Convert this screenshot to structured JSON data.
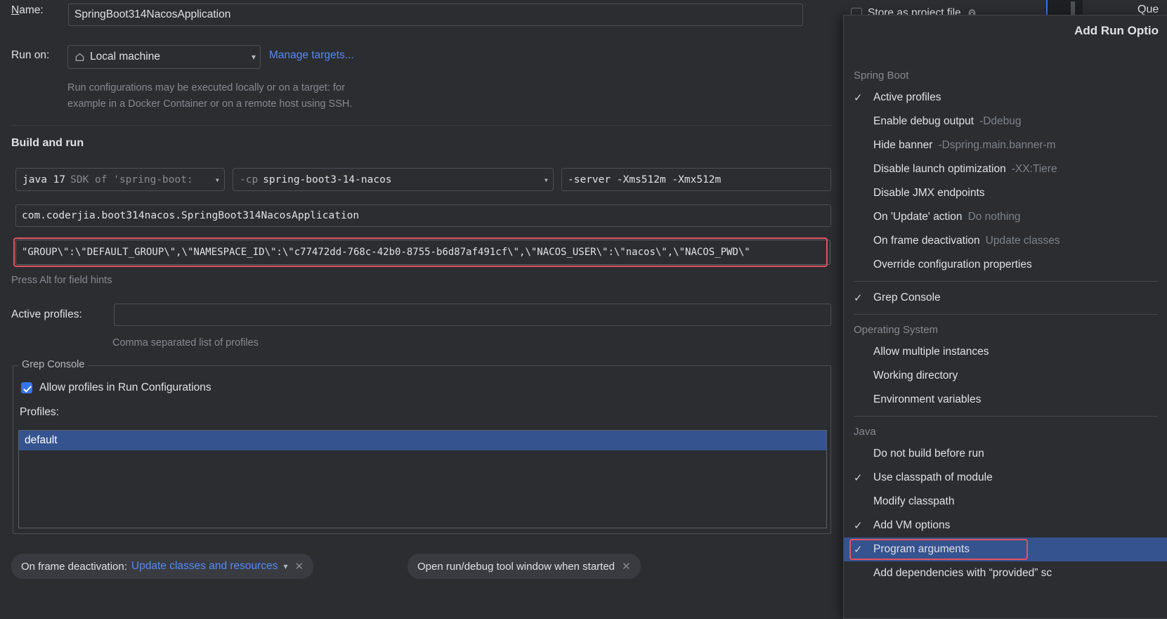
{
  "dialog": {
    "name_label": "Name:",
    "name_value": "SpringBoot314NacosApplication",
    "run_on_label": "Run on:",
    "run_on_value": "Local machine",
    "run_on_icon": "home-icon",
    "manage_targets_link": "Manage targets...",
    "run_on_hint_line1": "Run configurations may be executed locally or on a target: for",
    "run_on_hint_line2": "example in a Docker Container or on a remote host using SSH.",
    "build_and_run_title": "Build and run",
    "jdk_value_bold": "java 17",
    "jdk_value_dim": "SDK of 'spring-boot:",
    "cp_prefix": "-cp",
    "cp_value": "spring-boot3-14-nacos",
    "vm_options_value": "-server -Xms512m -Xmx512m",
    "main_class_value": "com.coderjia.boot314nacos.SpringBoot314NacosApplication",
    "program_arguments_value": "\"GROUP\\\":\\\"DEFAULT_GROUP\\\",\\\"NAMESPACE_ID\\\":\\\"c77472dd-768c-42b0-8755-b6d87af491cf\\\",\\\"NACOS_USER\\\":\\\"nacos\\\",\\\"NACOS_PWD\\\"",
    "field_hints": "Press Alt for field hints",
    "active_profiles_label": "Active profiles:",
    "active_profiles_value": "",
    "active_profiles_hint": "Comma separated list of profiles",
    "grep_console_group": "Grep Console",
    "allow_profiles_label": "Allow profiles in Run Configurations",
    "allow_profiles_checked": true,
    "profiles_label": "Profiles:",
    "profiles_items": [
      "default"
    ],
    "store_as_project_file": "Store as project file",
    "store_as_project_file_checked": false,
    "store_gear_icon": "gear-icon",
    "que_text": "Que"
  },
  "bottom_chips": [
    {
      "label": "On frame deactivation:",
      "value": "Update classes and resources",
      "has_dropdown": true,
      "close_icon": "close-icon"
    },
    {
      "label": "Open run/debug tool window when started",
      "value": "",
      "has_dropdown": false,
      "close_icon": "close-icon"
    }
  ],
  "popup": {
    "title": "Add Run Optio",
    "groups": [
      {
        "name": "Spring Boot",
        "items": [
          {
            "label": "Active profiles",
            "sub": "",
            "checked": true,
            "selected": false
          },
          {
            "label": "Enable debug output",
            "sub": "-Ddebug",
            "checked": false,
            "selected": false
          },
          {
            "label": "Hide banner",
            "sub": "-Dspring.main.banner-m",
            "checked": false,
            "selected": false
          },
          {
            "label": "Disable launch optimization",
            "sub": "-XX:Tiere",
            "checked": false,
            "selected": false
          },
          {
            "label": "Disable JMX endpoints",
            "sub": "",
            "checked": false,
            "selected": false
          },
          {
            "label": "On 'Update' action",
            "sub": "Do nothing",
            "checked": false,
            "selected": false
          },
          {
            "label": "On frame deactivation",
            "sub": "Update classes",
            "checked": false,
            "selected": false
          },
          {
            "label": "Override configuration properties",
            "sub": "",
            "checked": false,
            "selected": false
          }
        ]
      },
      {
        "name": "",
        "items": [
          {
            "label": "Grep Console",
            "sub": "",
            "checked": true,
            "selected": false
          }
        ]
      },
      {
        "name": "Operating System",
        "items": [
          {
            "label": "Allow multiple instances",
            "sub": "",
            "checked": false,
            "selected": false
          },
          {
            "label": "Working directory",
            "sub": "",
            "checked": false,
            "selected": false
          },
          {
            "label": "Environment variables",
            "sub": "",
            "checked": false,
            "selected": false
          }
        ]
      },
      {
        "name": "Java",
        "items": [
          {
            "label": "Do not build before run",
            "sub": "",
            "checked": false,
            "selected": false
          },
          {
            "label": "Use classpath of module",
            "sub": "",
            "checked": true,
            "selected": false
          },
          {
            "label": "Modify classpath",
            "sub": "",
            "checked": false,
            "selected": false
          },
          {
            "label": "Add VM options",
            "sub": "",
            "checked": true,
            "selected": false
          },
          {
            "label": "Program arguments",
            "sub": "",
            "checked": true,
            "selected": true
          },
          {
            "label": "Add dependencies with “provided” sc",
            "sub": "",
            "checked": false,
            "selected": false
          }
        ]
      }
    ],
    "checkmark_glyph": "✓"
  },
  "colors": {
    "background": "#2b2d30",
    "accent_blue": "#3574f0",
    "link_blue": "#548af7",
    "selection_blue": "#35538f",
    "error_red": "#e35260",
    "border": "#4b4f56",
    "text": "#dfe1e5",
    "dim_text": "#868a91"
  }
}
